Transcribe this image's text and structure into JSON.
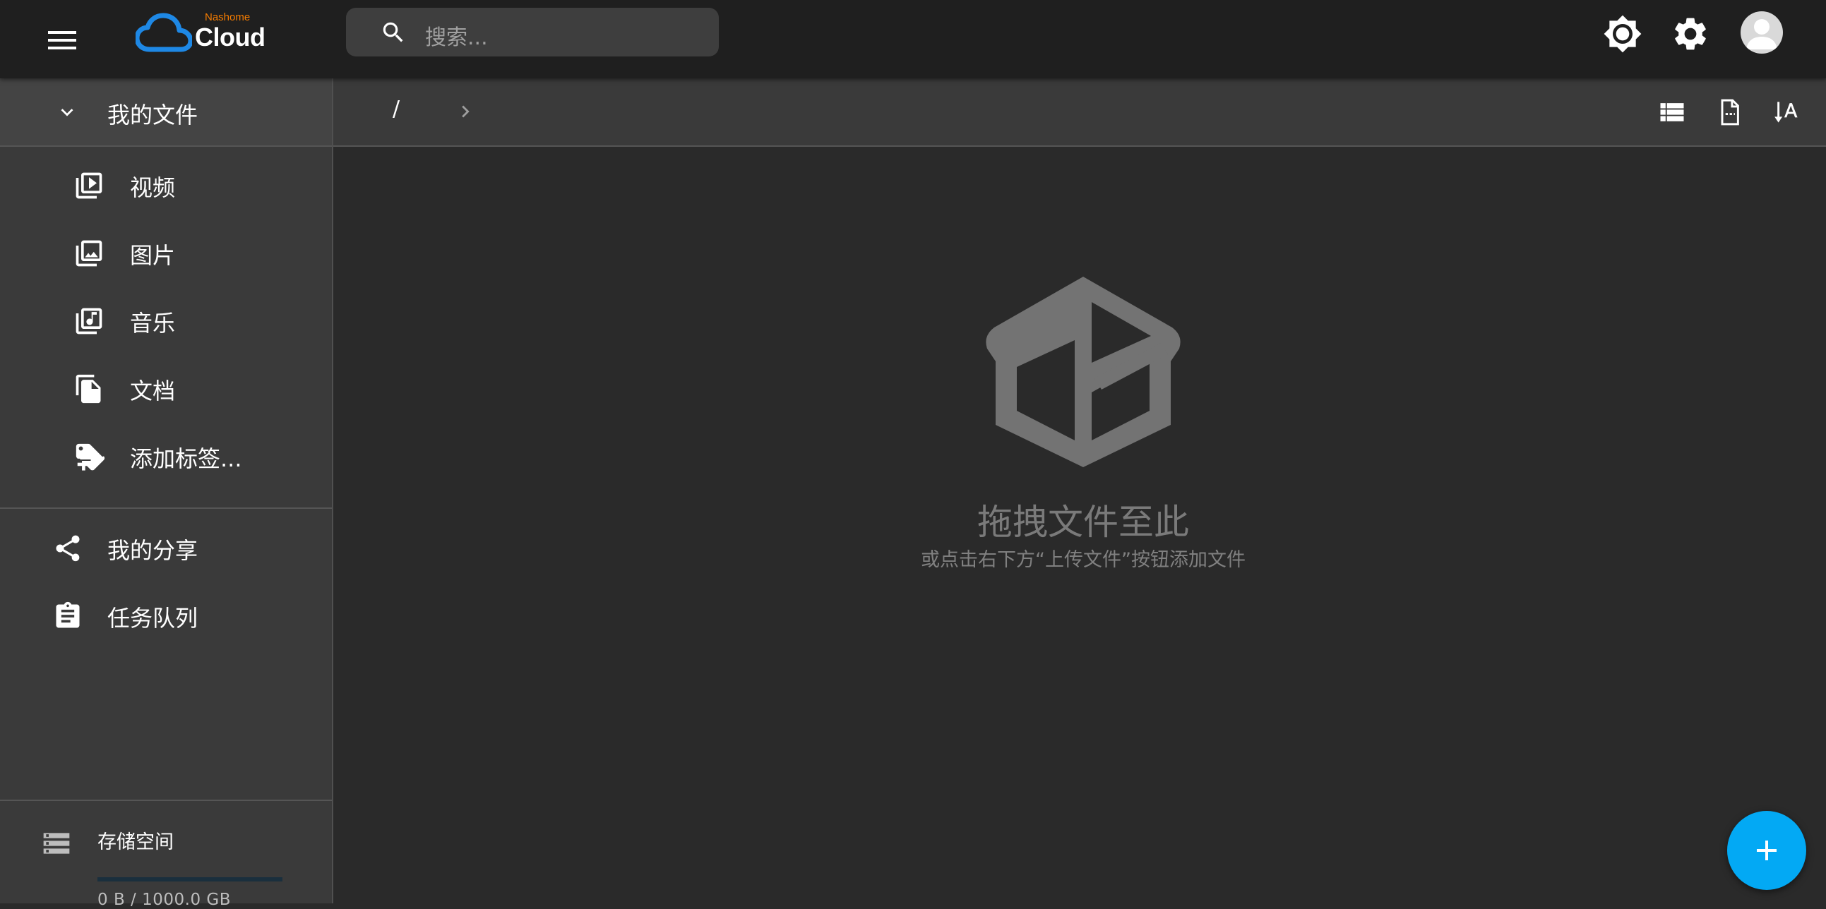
{
  "header": {
    "logo_small": "Nashome",
    "logo_big": "Cloud",
    "search_placeholder": "搜索..."
  },
  "sidebar": {
    "my_files": "我的文件",
    "items": [
      {
        "label": "视频",
        "icon": "video-library-icon"
      },
      {
        "label": "图片",
        "icon": "photo-library-icon"
      },
      {
        "label": "音乐",
        "icon": "music-library-icon"
      },
      {
        "label": "文档",
        "icon": "document-copy-icon"
      },
      {
        "label": "添加标签...",
        "icon": "add-tag-icon"
      }
    ],
    "share": "我的分享",
    "tasks": "任务队列",
    "storage": {
      "title": "存储空间",
      "usage": "0 B / 1000.0 GB",
      "used_fraction": 0.0
    }
  },
  "toolbar": {
    "path_root": "/"
  },
  "main": {
    "empty_title": "拖拽文件至此",
    "empty_subtitle": "或点击右下方“上传文件”按钮添加文件"
  },
  "colors": {
    "accent": "#03a9f4",
    "logo_blue": "#1e88e5",
    "logo_orange": "#f57c00",
    "background": "#2a2a2a",
    "topbar": "#1f1f1f",
    "sidebar": "#3a3a3a"
  }
}
